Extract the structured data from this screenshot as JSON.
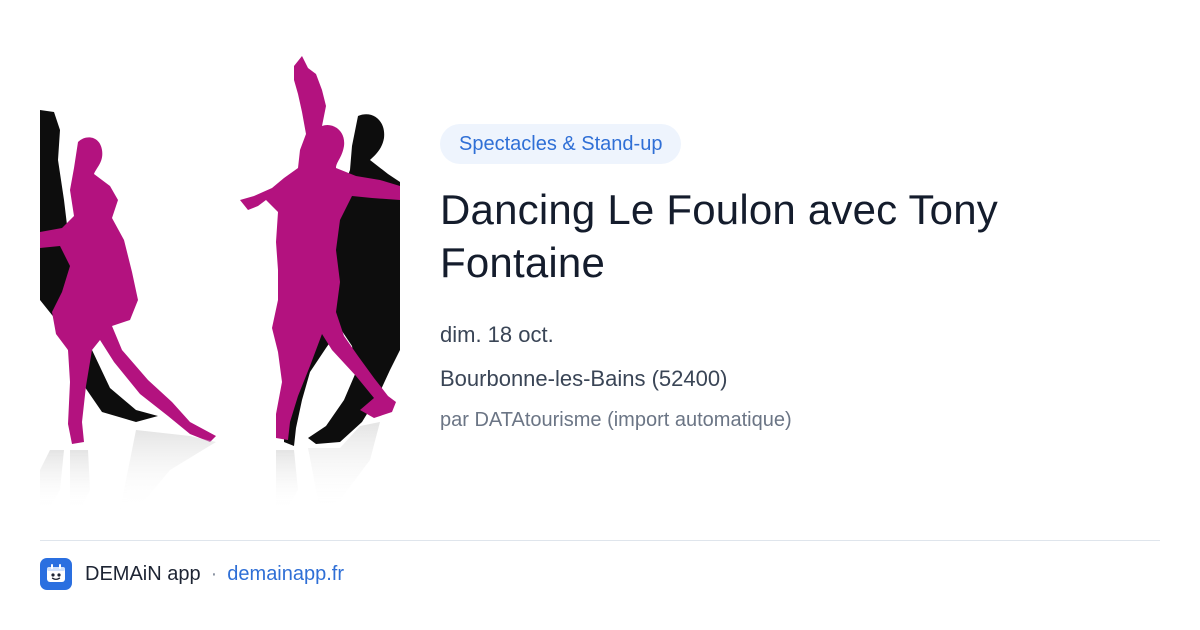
{
  "event": {
    "category": "Spectacles & Stand-up",
    "title": "Dancing Le Foulon avec Tony Fontaine",
    "date": "dim. 18 oct.",
    "location": "Bourbonne-les-Bains (52400)",
    "source": "par DATAtourisme (import automatique)",
    "image_description_icon": "dancers-silhouette-image"
  },
  "footer": {
    "app_name": "DEMAiN app",
    "separator": "·",
    "url": "demainapp.fr",
    "logo_icon": "demain-app-logo-icon"
  },
  "colors": {
    "accent": "#2f6fd6",
    "pill_background": "#eef4fd",
    "title": "#141c2c",
    "dancer_dress": "#b3127f",
    "dancer_suit": "#0d0d0d"
  }
}
